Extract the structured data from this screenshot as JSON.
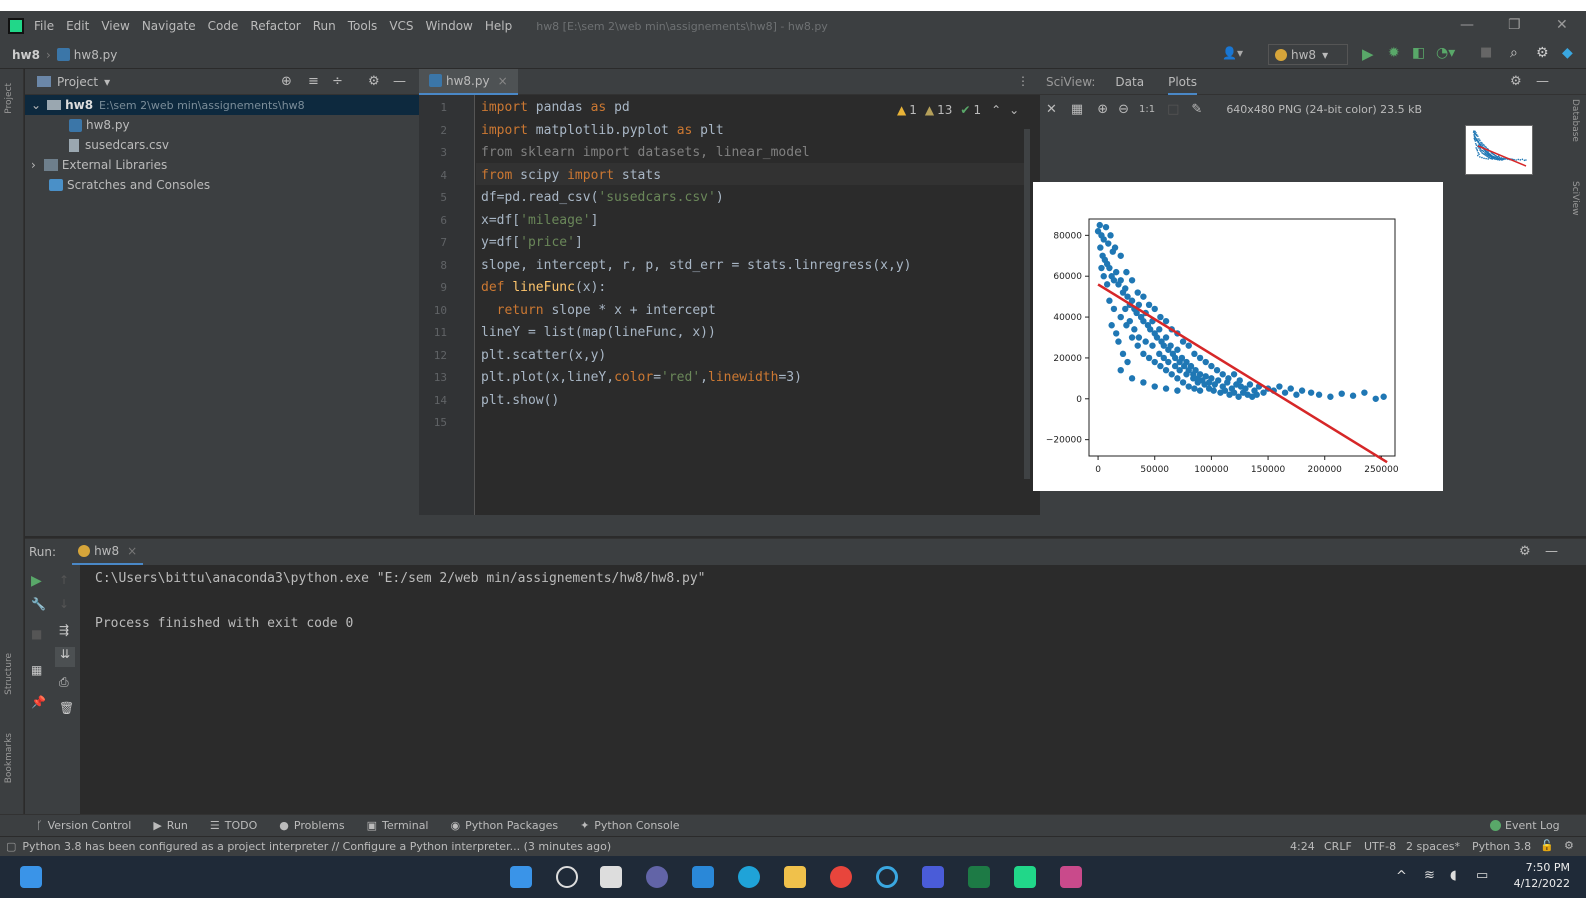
{
  "menu": {
    "items": [
      "File",
      "Edit",
      "View",
      "Navigate",
      "Code",
      "Refactor",
      "Run",
      "Tools",
      "VCS",
      "Window",
      "Help"
    ],
    "title": "hw8 [E:\\sem 2\\web min\\assignements\\hw8] - hw8.py"
  },
  "nav": {
    "project": "hw8",
    "file": "hw8.py",
    "run_config": "hw8"
  },
  "project_panel": {
    "title": "Project",
    "root_name": "hw8",
    "root_path": "E:\\sem 2\\web min\\assignements\\hw8",
    "files": [
      "hw8.py",
      "susedcars.csv"
    ],
    "external": "External Libraries",
    "scratches": "Scratches and Consoles"
  },
  "editor": {
    "tab": "hw8.py",
    "inspections": {
      "warn": "1",
      "weak": "13",
      "ok": "1"
    },
    "line_numbers": [
      "1",
      "2",
      "3",
      "4",
      "5",
      "6",
      "7",
      "8",
      "9",
      "10",
      "11",
      "12",
      "13",
      "14",
      "15"
    ]
  },
  "sciview": {
    "title": "SciView:",
    "tabs": [
      "Data",
      "Plots"
    ],
    "image_info": "640x480 PNG (24-bit color) 23.5 kB",
    "zoom_label": "1:1"
  },
  "chart_data": {
    "type": "scatter",
    "x_ticks": [
      "0",
      "50000",
      "100000",
      "150000",
      "200000",
      "250000"
    ],
    "y_ticks": [
      "80000",
      "60000",
      "40000",
      "20000",
      "0",
      "−20000"
    ],
    "xlim": [
      -8000,
      262000
    ],
    "ylim": [
      -28000,
      88000
    ],
    "scatter_color": "#1f77b4",
    "line_color": "#d62728",
    "regression_line": {
      "x": [
        0,
        255000
      ],
      "y": [
        56000,
        -31000
      ]
    },
    "points": [
      [
        0,
        82000
      ],
      [
        1500,
        85000
      ],
      [
        3000,
        80000
      ],
      [
        5000,
        78000
      ],
      [
        7000,
        84000
      ],
      [
        9000,
        76000
      ],
      [
        11000,
        80000
      ],
      [
        13000,
        72000
      ],
      [
        15000,
        74000
      ],
      [
        2000,
        74000
      ],
      [
        4000,
        70000
      ],
      [
        6000,
        68000
      ],
      [
        8000,
        66000
      ],
      [
        10000,
        64000
      ],
      [
        12000,
        60000
      ],
      [
        14000,
        58000
      ],
      [
        16000,
        62000
      ],
      [
        18000,
        56000
      ],
      [
        20000,
        58000
      ],
      [
        22000,
        52000
      ],
      [
        24000,
        54000
      ],
      [
        26000,
        50000
      ],
      [
        28000,
        46000
      ],
      [
        30000,
        48000
      ],
      [
        32000,
        44000
      ],
      [
        34000,
        42000
      ],
      [
        36000,
        46000
      ],
      [
        38000,
        40000
      ],
      [
        40000,
        38000
      ],
      [
        42000,
        42000
      ],
      [
        44000,
        36000
      ],
      [
        46000,
        34000
      ],
      [
        48000,
        38000
      ],
      [
        50000,
        32000
      ],
      [
        52000,
        30000
      ],
      [
        54000,
        34000
      ],
      [
        56000,
        28000
      ],
      [
        58000,
        26000
      ],
      [
        60000,
        30000
      ],
      [
        62000,
        24000
      ],
      [
        64000,
        26000
      ],
      [
        66000,
        22000
      ],
      [
        68000,
        20000
      ],
      [
        70000,
        24000
      ],
      [
        72000,
        18000
      ],
      [
        74000,
        20000
      ],
      [
        76000,
        16000
      ],
      [
        78000,
        18000
      ],
      [
        80000,
        14000
      ],
      [
        82000,
        16000
      ],
      [
        84000,
        12000
      ],
      [
        86000,
        14000
      ],
      [
        88000,
        10000
      ],
      [
        90000,
        12000
      ],
      [
        92000,
        9000
      ],
      [
        95000,
        11000
      ],
      [
        98000,
        8000
      ],
      [
        100000,
        10000
      ],
      [
        103000,
        7000
      ],
      [
        106000,
        9000
      ],
      [
        110000,
        6000
      ],
      [
        114000,
        8000
      ],
      [
        118000,
        5000
      ],
      [
        122000,
        7000
      ],
      [
        126000,
        6000
      ],
      [
        130000,
        5000
      ],
      [
        134000,
        7000
      ],
      [
        138000,
        4000
      ],
      [
        142000,
        6000
      ],
      [
        146000,
        3000
      ],
      [
        150000,
        5000
      ],
      [
        155000,
        4000
      ],
      [
        160000,
        6000
      ],
      [
        165000,
        3000
      ],
      [
        170000,
        5000
      ],
      [
        175000,
        2000
      ],
      [
        180000,
        4000
      ],
      [
        188000,
        3000
      ],
      [
        195000,
        2000
      ],
      [
        205000,
        1000
      ],
      [
        215000,
        2500
      ],
      [
        225000,
        1500
      ],
      [
        235000,
        3000
      ],
      [
        245000,
        0
      ],
      [
        252000,
        1000
      ],
      [
        20000,
        70000
      ],
      [
        25000,
        62000
      ],
      [
        30000,
        58000
      ],
      [
        35000,
        52000
      ],
      [
        40000,
        50000
      ],
      [
        45000,
        46000
      ],
      [
        50000,
        44000
      ],
      [
        55000,
        40000
      ],
      [
        60000,
        38000
      ],
      [
        65000,
        34000
      ],
      [
        70000,
        32000
      ],
      [
        75000,
        28000
      ],
      [
        80000,
        26000
      ],
      [
        85000,
        22000
      ],
      [
        90000,
        20000
      ],
      [
        95000,
        18000
      ],
      [
        100000,
        16000
      ],
      [
        105000,
        14000
      ],
      [
        110000,
        12000
      ],
      [
        115000,
        10000
      ],
      [
        120000,
        12000
      ],
      [
        125000,
        9000
      ],
      [
        20000,
        40000
      ],
      [
        25000,
        36000
      ],
      [
        30000,
        30000
      ],
      [
        35000,
        26000
      ],
      [
        40000,
        22000
      ],
      [
        45000,
        20000
      ],
      [
        50000,
        18000
      ],
      [
        55000,
        16000
      ],
      [
        60000,
        14000
      ],
      [
        65000,
        12000
      ],
      [
        70000,
        10000
      ],
      [
        75000,
        8000
      ],
      [
        80000,
        6000
      ],
      [
        85000,
        5000
      ],
      [
        90000,
        4000
      ],
      [
        20000,
        14000
      ],
      [
        30000,
        10000
      ],
      [
        40000,
        8000
      ],
      [
        50000,
        6000
      ],
      [
        60000,
        5000
      ],
      [
        70000,
        4000
      ],
      [
        18000,
        28000
      ],
      [
        22000,
        22000
      ],
      [
        26000,
        18000
      ],
      [
        10000,
        48000
      ],
      [
        14000,
        44000
      ],
      [
        8000,
        56000
      ],
      [
        5000,
        60000
      ],
      [
        3000,
        64000
      ],
      [
        12000,
        36000
      ],
      [
        16000,
        32000
      ],
      [
        24000,
        44000
      ],
      [
        28000,
        38000
      ],
      [
        32000,
        34000
      ],
      [
        36000,
        30000
      ],
      [
        42000,
        28000
      ],
      [
        48000,
        26000
      ],
      [
        54000,
        22000
      ],
      [
        58000,
        20000
      ],
      [
        62000,
        18000
      ],
      [
        68000,
        16000
      ],
      [
        72000,
        14000
      ],
      [
        78000,
        12000
      ],
      [
        84000,
        10000
      ],
      [
        88000,
        8000
      ],
      [
        94000,
        7000
      ],
      [
        98000,
        5000
      ],
      [
        102000,
        4000
      ],
      [
        108000,
        3000
      ],
      [
        112000,
        4000
      ],
      [
        116000,
        2000
      ],
      [
        120000,
        3000
      ],
      [
        124000,
        1000
      ],
      [
        128000,
        3000
      ],
      [
        132000,
        2000
      ],
      [
        136000,
        1000
      ],
      [
        140000,
        2000
      ]
    ]
  },
  "run_panel": {
    "label": "Run:",
    "tab": "hw8",
    "command": "C:\\Users\\bittu\\anaconda3\\python.exe \"E:/sem 2/web min/assignements/hw8/hw8.py\"",
    "result": "Process finished with exit code 0"
  },
  "left_stripe": {
    "project": "Project",
    "structure": "Structure",
    "bookmarks": "Bookmarks"
  },
  "right_stripe": {
    "database": "Database",
    "sciview": "SciView"
  },
  "toolbar": {
    "items": [
      "Version Control",
      "Run",
      "TODO",
      "Problems",
      "Terminal",
      "Python Packages",
      "Python Console"
    ],
    "event_log": "Event Log"
  },
  "status": {
    "message": "Python 3.8 has been configured as a project interpreter // Configure a Python interpreter... (3 minutes ago)",
    "position": "4:24",
    "line_sep": "CRLF",
    "encoding": "UTF-8",
    "indent": "2 spaces*",
    "interpreter": "Python 3.8"
  },
  "taskbar": {
    "time": "7:50 PM",
    "date": "4/12/2022"
  }
}
